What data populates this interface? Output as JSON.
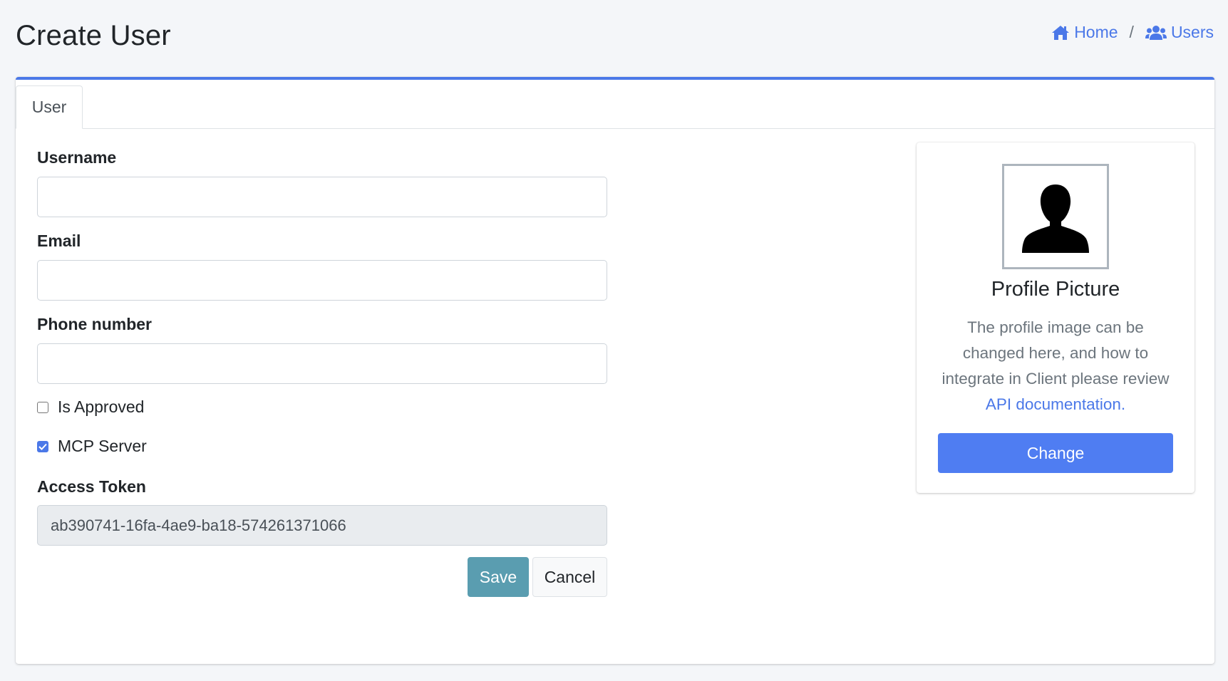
{
  "page": {
    "title": "Create User"
  },
  "breadcrumb": {
    "home": "Home",
    "separator": "/",
    "users": "Users"
  },
  "tabs": [
    {
      "label": "User",
      "active": true
    }
  ],
  "form": {
    "username": {
      "label": "Username",
      "value": "",
      "placeholder": ""
    },
    "email": {
      "label": "Email",
      "value": "",
      "placeholder": ""
    },
    "phone": {
      "label": "Phone number",
      "value": "",
      "placeholder": ""
    },
    "is_approved": {
      "label": "Is Approved",
      "checked": false
    },
    "mcp_server": {
      "label": "MCP Server",
      "checked": true
    },
    "access_token": {
      "label": "Access Token",
      "value": "ab390741-16fa-4ae9-ba18-574261371066"
    },
    "save_label": "Save",
    "cancel_label": "Cancel"
  },
  "profile": {
    "title": "Profile Picture",
    "description": "The profile image can be changed here, and how to integrate in Client please review",
    "link_text": "API documentation.",
    "change_label": "Change",
    "avatar_icon": "user-silhouette-icon"
  },
  "icons": {
    "home": "home-icon",
    "users": "users-icon"
  },
  "colors": {
    "accent": "#4b78e8",
    "save_button": "#5a9db0",
    "change_button": "#4f7df2",
    "background": "#f4f6f9"
  }
}
